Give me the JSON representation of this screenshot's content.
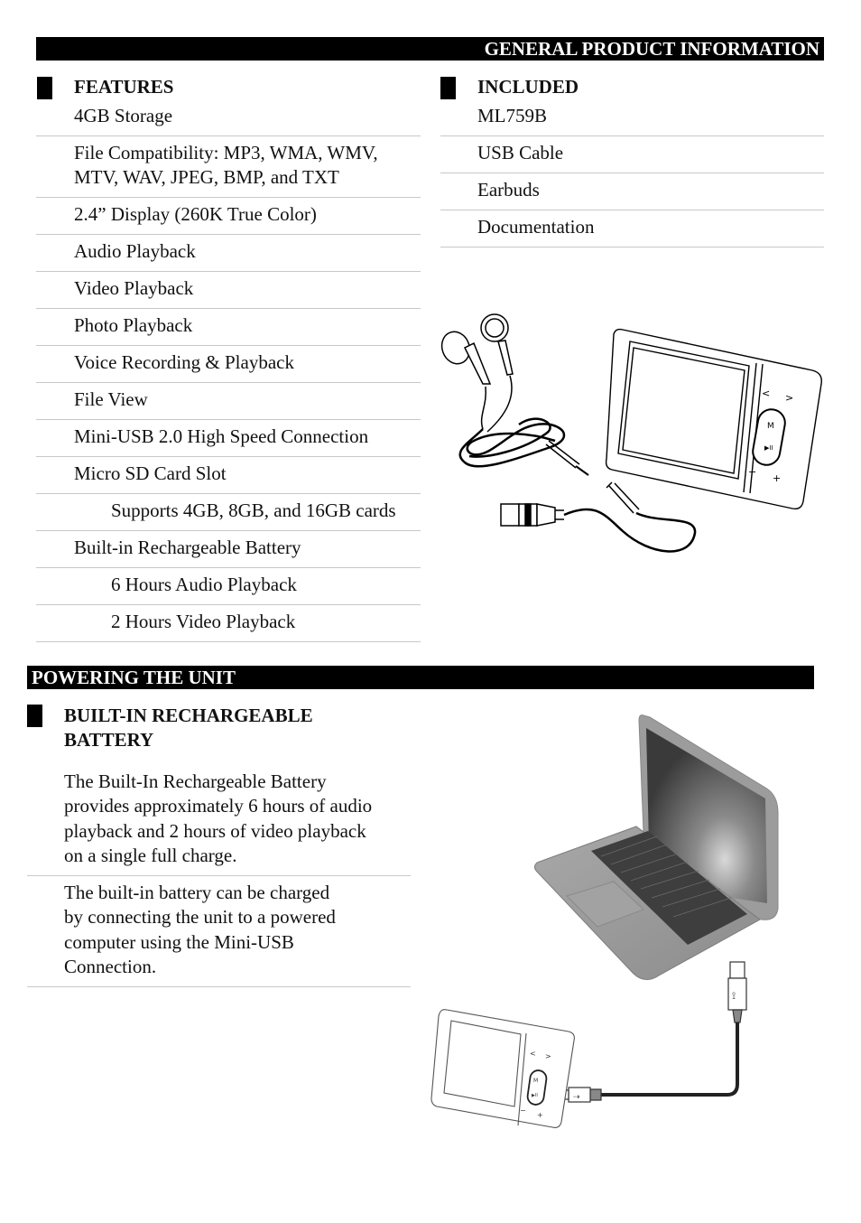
{
  "general": {
    "bar_title": "GENERAL PRODUCT INFORMATION",
    "features": {
      "heading": "FEATURES",
      "items": [
        {
          "text": "4GB Storage",
          "indent": false
        },
        {
          "text": "File Compatibility: MP3, WMA, WMV,",
          "text2": "MTV, WAV, JPEG, BMP, and TXT",
          "indent": false
        },
        {
          "text": "2.4” Display (260K True Color)",
          "indent": false
        },
        {
          "text": "Audio Playback",
          "indent": false
        },
        {
          "text": "Video Playback",
          "indent": false
        },
        {
          "text": "Photo Playback",
          "indent": false
        },
        {
          "text": "Voice Recording & Playback",
          "indent": false
        },
        {
          "text": "File View",
          "indent": false
        },
        {
          "text": "Mini-USB 2.0 High Speed Connection",
          "indent": false
        },
        {
          "text": "Micro SD Card Slot",
          "indent": false
        },
        {
          "text": "Supports 4GB, 8GB, and 16GB cards",
          "indent": true
        },
        {
          "text": "Built-in Rechargeable Battery",
          "indent": false
        },
        {
          "text": "6 Hours Audio Playback",
          "indent": true
        },
        {
          "text": "2 Hours Video Playback",
          "indent": true
        }
      ]
    },
    "included": {
      "heading": "INCLUDED",
      "items": [
        "ML759B",
        "USB Cable",
        "Earbuds",
        "Documentation"
      ]
    },
    "illustration": {
      "subject": "MP3 player with earbuds and USB cable",
      "device_buttons": [
        "<",
        ">",
        "M",
        "▶II",
        "−",
        "+"
      ]
    }
  },
  "powering": {
    "bar_title": "POWERING THE UNIT",
    "heading_line1": "BUILT-IN RECHARGEABLE",
    "heading_line2": "BATTERY",
    "paragraphs": [
      [
        "The Built-In Rechargeable Battery",
        "provides approximately 6 hours of audio",
        "playback and 2 hours of video playback",
        "on a single full charge."
      ],
      [
        "The built-in battery can be charged",
        "by connecting the unit to a powered",
        "computer using the Mini-USB",
        "Connection."
      ]
    ],
    "illustration": {
      "subject": "Laptop connected to player via Mini-USB cable",
      "device_buttons": [
        "<",
        ">",
        "M",
        "▶II",
        "−",
        "+"
      ]
    }
  }
}
